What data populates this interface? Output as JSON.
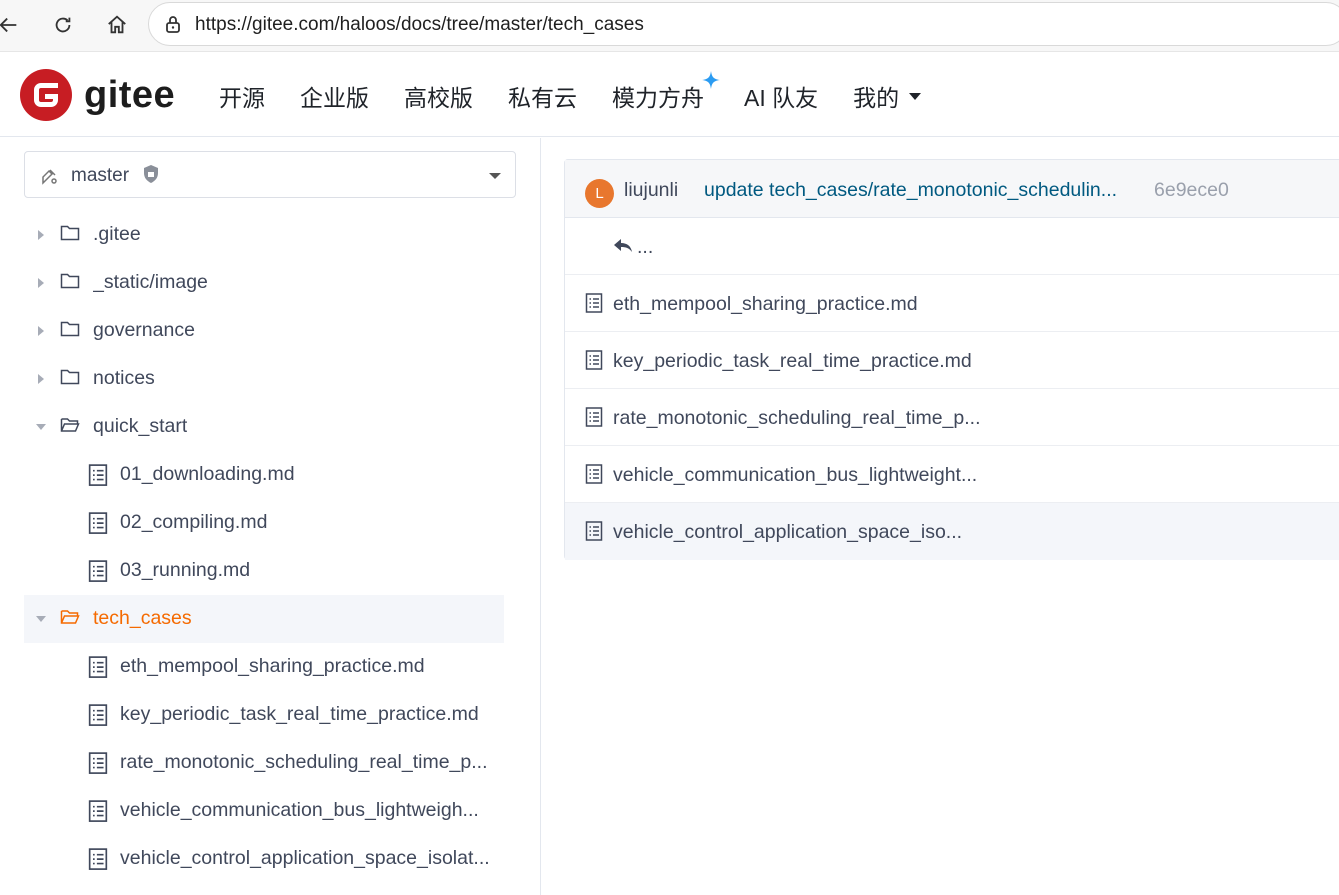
{
  "browser": {
    "url": "https://gitee.com/haloos/docs/tree/master/tech_cases"
  },
  "header": {
    "logo_text": "gitee",
    "brand_color": "#c71d23",
    "nav": [
      "开源",
      "企业版",
      "高校版",
      "私有云",
      "模力方舟",
      "AI 队友",
      "我的"
    ]
  },
  "sidebar": {
    "branch": "master",
    "tree": [
      {
        "label": ".gitee",
        "type": "folder",
        "expanded": false
      },
      {
        "label": "_static/image",
        "type": "folder",
        "expanded": false
      },
      {
        "label": "governance",
        "type": "folder",
        "expanded": false
      },
      {
        "label": "notices",
        "type": "folder",
        "expanded": false
      },
      {
        "label": "quick_start",
        "type": "folder",
        "expanded": true
      },
      {
        "label": "01_downloading.md",
        "type": "file"
      },
      {
        "label": "02_compiling.md",
        "type": "file"
      },
      {
        "label": "03_running.md",
        "type": "file"
      },
      {
        "label": "tech_cases",
        "type": "folder",
        "expanded": true,
        "active": true
      },
      {
        "label": "eth_mempool_sharing_practice.md",
        "type": "file"
      },
      {
        "label": "key_periodic_task_real_time_practice.md",
        "type": "file"
      },
      {
        "label": "rate_monotonic_scheduling_real_time_p...",
        "type": "file"
      },
      {
        "label": "vehicle_communication_bus_lightweigh...",
        "type": "file"
      },
      {
        "label": "vehicle_control_application_space_isolat...",
        "type": "file"
      }
    ]
  },
  "commit": {
    "avatar_letter": "L",
    "author": "liujunli",
    "message": "update tech_cases/rate_monotonic_schedulin...",
    "hash": "6e9ece0"
  },
  "files": {
    "parent_label": "...",
    "items": [
      "eth_mempool_sharing_practice.md",
      "key_periodic_task_real_time_practice.md",
      "rate_monotonic_scheduling_real_time_p...",
      "vehicle_communication_bus_lightweight...",
      "vehicle_control_application_space_iso..."
    ]
  }
}
